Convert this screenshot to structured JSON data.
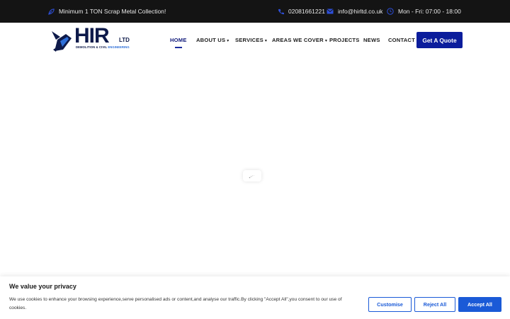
{
  "topbar": {
    "promo": "Minimum 1 TON Scrap Metal Collection!",
    "phone": "02081661221",
    "email": "info@hirltd.co.uk",
    "hours": "Mon - Fri: 07:00 - 18:00",
    "icons": {
      "promo": "leaf-icon",
      "phone": "phone-icon",
      "email": "envelope-icon",
      "hours": "clock-icon"
    },
    "icon_color": "#2e4fd8"
  },
  "logo": {
    "brand": "HIR",
    "suffix": "LTD",
    "tagline_main": "DEMOLITION & CIVIL",
    "tagline_accent": "ENGINEERING"
  },
  "nav": {
    "items": [
      {
        "label": "HOME",
        "active": true
      },
      {
        "label": "ABOUT US",
        "dropdown": true
      },
      {
        "label": "SERVICES",
        "dropdown": true
      },
      {
        "label": "AREAS WE COVER",
        "dropdown": true
      },
      {
        "label": "PROJECTS"
      },
      {
        "label": "NEWS"
      },
      {
        "label": "CONTACT"
      }
    ],
    "caret": "▾",
    "cta": "Get A Quote",
    "cta_color": "#0b1d9c"
  },
  "cookie": {
    "title": "We value your privacy",
    "text": "We use cookies to enhance your browsing experience,serve personalised ads or content,and analyse our traffic.By clicking \"Accept All\",you consent to our use of cookies.",
    "customise": "Customise",
    "reject": "Reject All",
    "accept": "Accept All",
    "accent": "#1a5ad7"
  }
}
